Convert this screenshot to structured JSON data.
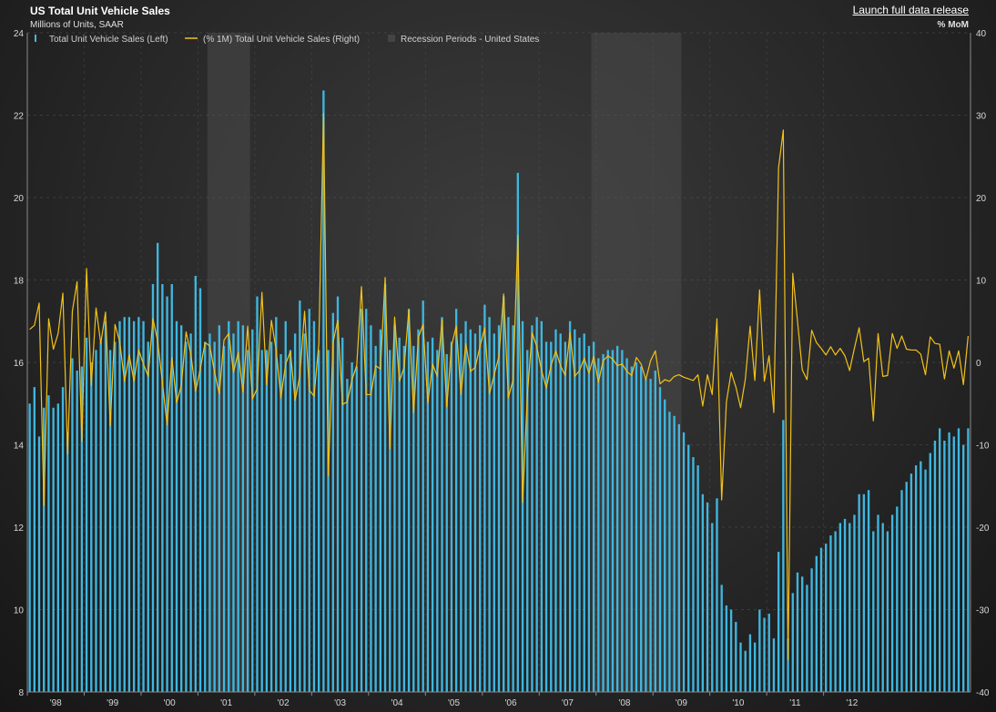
{
  "header": {
    "title": "US Total Unit Vehicle Sales",
    "subtitle": "Millions of Units, SAAR",
    "release_link": "Launch full data release",
    "right_unit": "% MoM"
  },
  "colors": {
    "bars": "#3fb7e0",
    "line": "#f2c21b",
    "recession": "#4a4a4a",
    "grid": "#5a5a5a"
  },
  "legend": [
    {
      "label": "Total Unit Vehicle Sales (Left)",
      "icon": "bar-icon"
    },
    {
      "label": "(% 1M) Total Unit Vehicle Sales  (Right)",
      "icon": "line-icon"
    },
    {
      "label": "Recession Periods - United States",
      "icon": "shade-icon"
    }
  ],
  "chart_data": {
    "type": "bar",
    "start": "1998-01",
    "left_axis": {
      "ylim": [
        8,
        24
      ],
      "ticks": [
        "8",
        "10",
        "12",
        "14",
        "16",
        "18",
        "20",
        "22",
        "24"
      ]
    },
    "right_axis": {
      "ylim": [
        -40,
        40
      ],
      "ticks": [
        "-40",
        "-30",
        "-20",
        "-10",
        "0",
        "10",
        "20",
        "30",
        "40"
      ]
    },
    "x_ticks": [
      "'98",
      "'99",
      "'00",
      "'01",
      "'02",
      "'03",
      "'04",
      "'05",
      "'06",
      "'07",
      "'08",
      "'09",
      "'10",
      "'11",
      "'12"
    ],
    "recessions": [
      [
        "2001-03",
        "2001-11"
      ],
      [
        "2007-12",
        "2009-06"
      ]
    ],
    "series": [
      {
        "name": "Total Unit Vehicle Sales (Left)",
        "axis": "left",
        "type": "bar",
        "values": [
          15.0,
          15.4,
          14.2,
          14.9,
          15.2,
          14.9,
          15.0,
          15.4,
          14.3,
          16.1,
          15.8,
          15.9,
          16.6,
          16.0,
          16.3,
          16.5,
          17.0,
          16.3,
          16.5,
          17.0,
          17.1,
          17.1,
          17.0,
          17.1,
          17.0,
          16.5,
          17.9,
          18.9,
          17.9,
          17.6,
          17.9,
          17.0,
          16.9,
          16.5,
          16.7,
          18.1,
          17.8,
          16.5,
          16.7,
          16.5,
          16.9,
          16.4,
          17.0,
          16.7,
          17.0,
          16.9,
          16.3,
          16.8,
          17.6,
          16.3,
          16.3,
          16.5,
          17.1,
          16.2,
          17.0,
          16.3,
          16.7,
          17.5,
          16.7,
          17.3,
          17.0,
          16.3,
          22.6,
          16.3,
          17.2,
          17.6,
          16.6,
          15.6,
          16.0,
          15.9,
          17.3,
          17.3,
          16.9,
          16.4,
          16.8,
          17.9,
          16.3,
          16.9,
          16.6,
          16.4,
          17.3,
          16.4,
          16.8,
          17.5,
          16.5,
          16.6,
          16.3,
          17.1,
          16.2,
          16.5,
          17.3,
          16.7,
          17.0,
          16.8,
          16.7,
          16.9,
          17.4,
          17.1,
          16.7,
          16.9,
          17.6,
          17.1,
          16.9,
          20.6,
          17.0,
          16.3,
          16.9,
          17.1,
          17.0,
          16.5,
          16.5,
          16.8,
          16.7,
          16.5,
          17.0,
          16.8,
          16.6,
          16.7,
          16.4,
          16.5,
          16.1,
          16.2,
          16.3,
          16.3,
          16.4,
          16.3,
          16.1,
          15.9,
          16.0,
          15.9,
          15.6,
          15.6,
          15.8,
          15.4,
          15.1,
          14.8,
          14.7,
          14.5,
          14.3,
          14.0,
          13.7,
          13.5,
          12.8,
          12.6,
          12.1,
          12.7,
          10.6,
          10.1,
          10.0,
          9.7,
          9.2,
          9.0,
          9.4,
          9.2,
          10.0,
          9.8,
          9.9,
          9.3,
          11.4,
          14.6,
          9.3,
          10.4,
          10.9,
          10.8,
          10.6,
          11.0,
          11.3,
          11.5,
          11.6,
          11.8,
          11.9,
          12.1,
          12.2,
          12.1,
          12.3,
          12.8,
          12.8,
          12.9,
          11.9,
          12.3,
          12.1,
          11.9,
          12.3,
          12.5,
          12.9,
          13.1,
          13.3,
          13.5,
          13.6,
          13.4,
          13.8,
          14.1,
          14.4,
          14.1,
          14.3,
          14.2,
          14.4,
          14.0,
          14.4
        ]
      },
      {
        "name": "(% 1M) Total Unit Vehicle Sales  (Right)",
        "axis": "right",
        "type": "line",
        "values": [
          4.0,
          4.5,
          7.2,
          -17.4,
          5.3,
          1.6,
          3.5,
          8.4,
          -11.1,
          6.2,
          9.8,
          -9.6,
          11.4,
          -2.8,
          6.6,
          2.3,
          6.1,
          -7.7,
          4.6,
          2.5,
          -2.3,
          0.9,
          -2.3,
          1.5,
          -0.2,
          -1.7,
          5.3,
          2.6,
          -2.4,
          -7.6,
          0.6,
          -4.9,
          -2.8,
          3.7,
          1.0,
          -3.5,
          -0.8,
          2.4,
          2.0,
          -1.2,
          -3.8,
          2.7,
          3.5,
          -1.2,
          1.2,
          -3.6,
          4.4,
          -4.4,
          -3.2,
          8.5,
          -2.7,
          5.1,
          1.5,
          -4.3,
          -0.2,
          1.3,
          -4.6,
          -1.6,
          6.2,
          -3.4,
          -4.1,
          2.2,
          30.2,
          -13.8,
          2.4,
          5.1,
          -5.1,
          -4.8,
          -2.1,
          -0.4,
          9.2,
          -3.9,
          -3.9,
          -0.4,
          -0.8,
          10.3,
          -10.5,
          5.5,
          -2.3,
          -0.6,
          6.4,
          -6.1,
          3.0,
          4.6,
          -4.9,
          -0.2,
          -1.7,
          5.2,
          -5.4,
          2.0,
          4.4,
          -3.9,
          2.3,
          -1.1,
          -0.6,
          1.9,
          4.2,
          -3.8,
          -1.5,
          0.7,
          8.3,
          -4.3,
          -2.1,
          15.4,
          -17.0,
          -4.0,
          3.6,
          1.9,
          -1.0,
          -3.1,
          -0.4,
          1.4,
          -0.4,
          -1.6,
          3.6,
          -1.7,
          -1.0,
          0.5,
          -1.3,
          0.7,
          -2.4,
          0.2,
          0.8,
          0.4,
          -0.4,
          -0.2,
          -1.1,
          -1.6,
          0.6,
          -0.2,
          -2.1,
          0.2,
          1.4,
          -2.6,
          -2.1,
          -2.3,
          -1.7,
          -1.5,
          -1.8,
          -2.0,
          -2.2,
          -1.5,
          -5.3,
          -1.5,
          -3.9,
          5.3,
          -16.7,
          -4.8,
          -1.2,
          -3.0,
          -5.5,
          -2.0,
          4.4,
          -2.2,
          8.8,
          -2.3,
          0.8,
          -6.1,
          23.6,
          28.2,
          -36.1,
          10.8,
          5.0,
          -0.9,
          -2.1,
          3.9,
          2.4,
          1.7,
          0.9,
          1.9,
          0.9,
          1.7,
          0.8,
          -1.0,
          1.7,
          4.2,
          0.1,
          0.5,
          -7.1,
          3.5,
          -1.7,
          -1.6,
          3.5,
          1.7,
          3.2,
          1.6,
          1.5,
          1.5,
          1.0,
          -1.5,
          3.1,
          2.3,
          2.2,
          -2.0,
          1.4,
          -0.7,
          1.4,
          -2.7,
          3.2
        ]
      }
    ]
  }
}
